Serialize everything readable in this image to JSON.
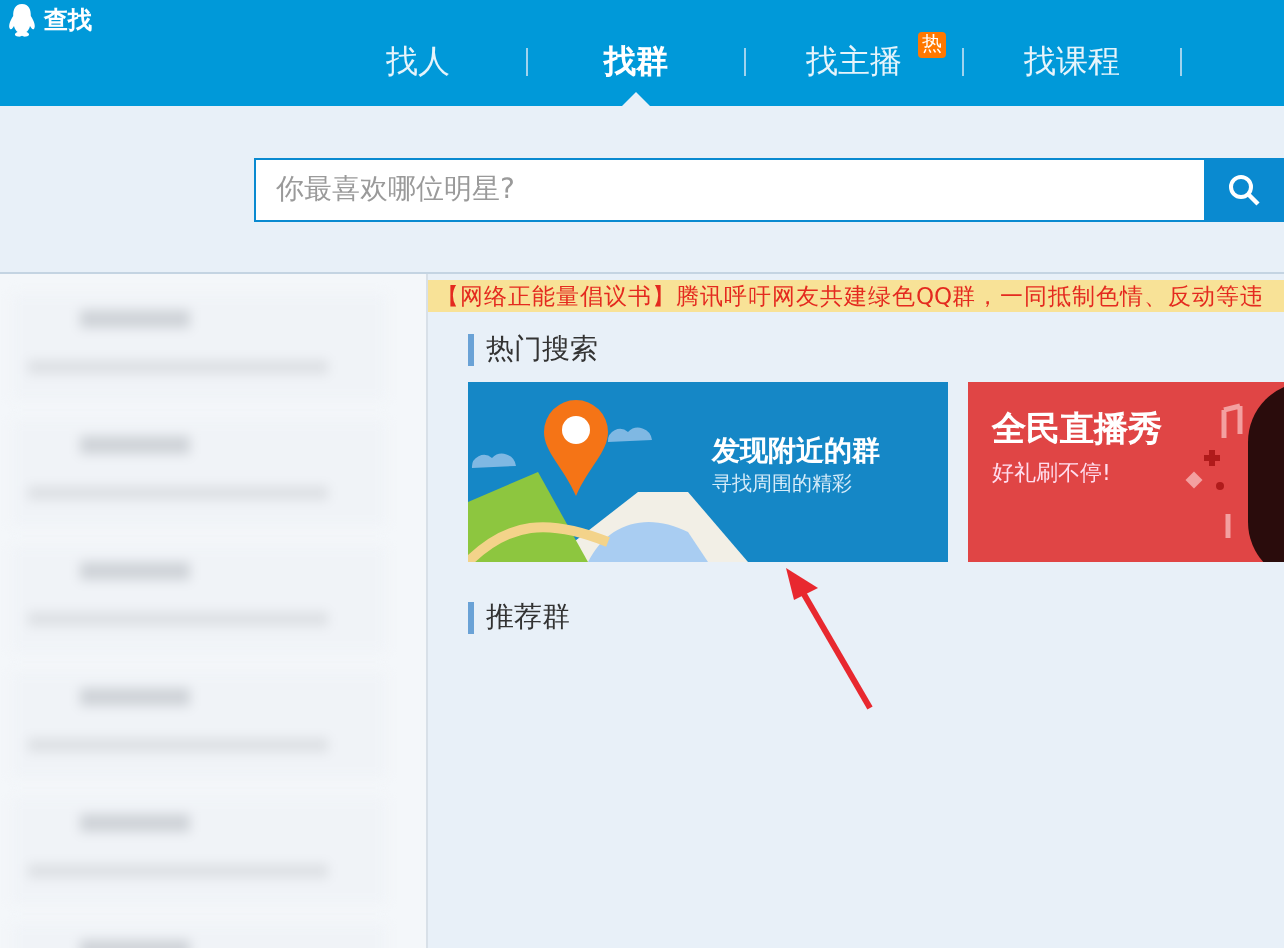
{
  "window": {
    "title": "查找"
  },
  "tabs": [
    {
      "label": "找人",
      "selected": false
    },
    {
      "label": "找群",
      "selected": true
    },
    {
      "label": "找主播",
      "selected": false,
      "badge": "热"
    },
    {
      "label": "找课程",
      "selected": false
    }
  ],
  "search": {
    "placeholder": "你最喜欢哪位明星?"
  },
  "notice": "【网络正能量倡议书】腾讯呼吁网友共建绿色QQ群，一同抵制色情、反动等违",
  "hot_section": {
    "title": "热门搜索",
    "cards": [
      {
        "kind": "map",
        "title": "发现附近的群",
        "subtitle": "寻找周围的精彩"
      },
      {
        "kind": "live",
        "title": "全民直播秀",
        "subtitle": "好礼刷不停!"
      }
    ]
  },
  "recommend_section": {
    "title": "推荐群"
  }
}
